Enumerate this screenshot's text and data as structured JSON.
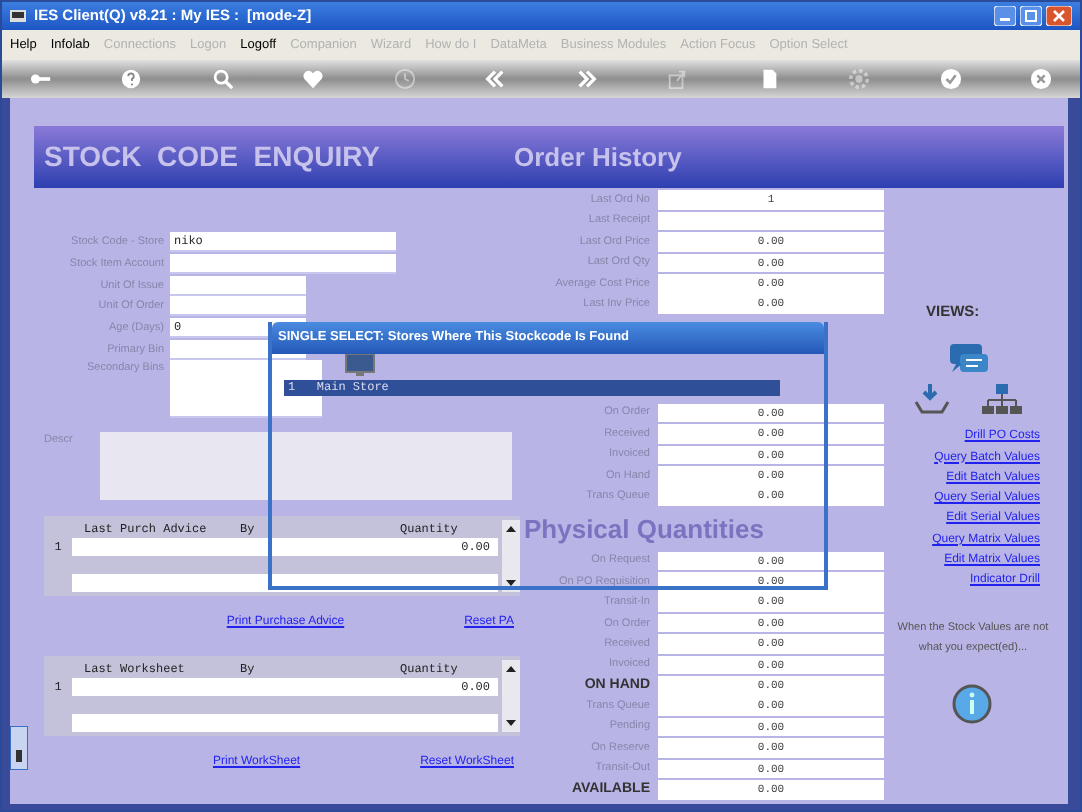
{
  "window": {
    "title": "IES Client(Q) v8.21 : My IES :",
    "mode": "[mode-Z]"
  },
  "menu": [
    {
      "label": "Help",
      "disabled": false
    },
    {
      "label": "Infolab",
      "disabled": false
    },
    {
      "label": "Connections",
      "disabled": true
    },
    {
      "label": "Logon",
      "disabled": true
    },
    {
      "label": "Logoff",
      "disabled": false
    },
    {
      "label": "Companion",
      "disabled": true
    },
    {
      "label": "Wizard",
      "disabled": true
    },
    {
      "label": "How do I",
      "disabled": true
    },
    {
      "label": "DataMeta",
      "disabled": true
    },
    {
      "label": "Business Modules",
      "disabled": true
    },
    {
      "label": "Action Focus",
      "disabled": true
    },
    {
      "label": "Option Select",
      "disabled": true
    }
  ],
  "toolbar": [
    {
      "kind": "key",
      "disabled": false
    },
    {
      "kind": "help",
      "disabled": false
    },
    {
      "kind": "search",
      "disabled": false
    },
    {
      "kind": "heart",
      "disabled": false
    },
    {
      "kind": "clock",
      "disabled": true
    },
    {
      "kind": "rewind",
      "disabled": false
    },
    {
      "kind": "forward",
      "disabled": false
    },
    {
      "kind": "export",
      "disabled": true
    },
    {
      "kind": "document",
      "disabled": false
    },
    {
      "kind": "gear",
      "disabled": true
    },
    {
      "kind": "check",
      "disabled": false
    },
    {
      "kind": "close",
      "disabled": false
    }
  ],
  "header": {
    "title": "STOCK  CODE  ENQUIRY",
    "section": "Order History"
  },
  "stock_fields": [
    {
      "label": "Stock Code - Store",
      "value": "niko",
      "kind": "wide"
    },
    {
      "label": "Stock Item Account",
      "kind": "wide"
    },
    {
      "label": "Unit Of Issue",
      "kind": "short"
    },
    {
      "label": "Unit Of Order",
      "kind": "short"
    },
    {
      "label": "Age (Days)",
      "value": "0",
      "kind": "short"
    },
    {
      "label": "Primary Bin",
      "kind": "short"
    },
    {
      "label": "Secondary Bins",
      "kind": "area"
    }
  ],
  "description": {
    "label": "Descr"
  },
  "order_history": [
    {
      "label": "Last Ord No",
      "value": "1"
    },
    {
      "label": "Last Receipt"
    },
    {
      "label": "Last Ord Price",
      "value": "0.00"
    },
    {
      "label": "Last Ord Qty",
      "value": "0.00"
    },
    {
      "label": "Average Cost Price",
      "value": "0.00"
    },
    {
      "label": "Last Inv Price",
      "value": "0.00"
    }
  ],
  "quantities": [
    {
      "label": "On Order",
      "value": "0.00"
    },
    {
      "label": "Received",
      "value": "0.00"
    },
    {
      "label": "Invoiced",
      "value": "0.00"
    },
    {
      "label": "On Hand",
      "value": "0.00"
    },
    {
      "label": "Trans Queue",
      "value": "0.00"
    }
  ],
  "physical": {
    "title": "Physical Quantities",
    "rows": [
      {
        "label": "On Request",
        "value": "0.00",
        "emphasis": false
      },
      {
        "label": "On PO Requisition",
        "value": "0.00",
        "emphasis": false
      },
      {
        "label": "Transit-In",
        "value": "0.00",
        "emphasis": false
      },
      {
        "label": "On Order",
        "value": "0.00",
        "emphasis": false
      },
      {
        "label": "Received",
        "value": "0.00",
        "emphasis": false
      },
      {
        "label": "Invoiced",
        "value": "0.00",
        "emphasis": false
      },
      {
        "label": "ON HAND",
        "value": "0.00",
        "emphasis": true
      },
      {
        "label": "Trans Queue",
        "value": "0.00",
        "emphasis": false
      },
      {
        "label": "Pending",
        "value": "0.00",
        "emphasis": false
      },
      {
        "label": "On Reserve",
        "value": "0.00",
        "emphasis": false
      },
      {
        "label": "Transit-Out",
        "value": "0.00",
        "emphasis": false
      },
      {
        "label": "AVAILABLE",
        "value": "0.00",
        "emphasis": true
      }
    ]
  },
  "views": {
    "title": "VIEWS:",
    "links": [
      "Drill PO Costs",
      "Query Batch Values",
      "Edit Batch Values",
      "Query Serial Values",
      "Edit Serial Values",
      "Query Matrix Values",
      "Edit Matrix Values",
      "Indicator Drill"
    ],
    "note": "When the Stock Values are not what you expect(ed)..."
  },
  "purchase_advice": {
    "columns": [
      "Last Purch Advice",
      "By",
      "Quantity"
    ],
    "rows": [
      {
        "number": "1",
        "quantity": "0.00"
      }
    ],
    "links": [
      "Print Purchase Advice",
      "Reset PA"
    ]
  },
  "worksheet": {
    "columns": [
      "Last Worksheet",
      "By",
      "Quantity"
    ],
    "rows": [
      {
        "number": "1",
        "quantity": "0.00"
      }
    ],
    "links": [
      "Print WorkSheet",
      "Reset WorkSheet"
    ]
  },
  "dialog": {
    "title": "SINGLE SELECT: Stores Where This Stockcode Is Found",
    "items": [
      {
        "number": "1",
        "label": "Main Store",
        "selected": true
      }
    ]
  }
}
